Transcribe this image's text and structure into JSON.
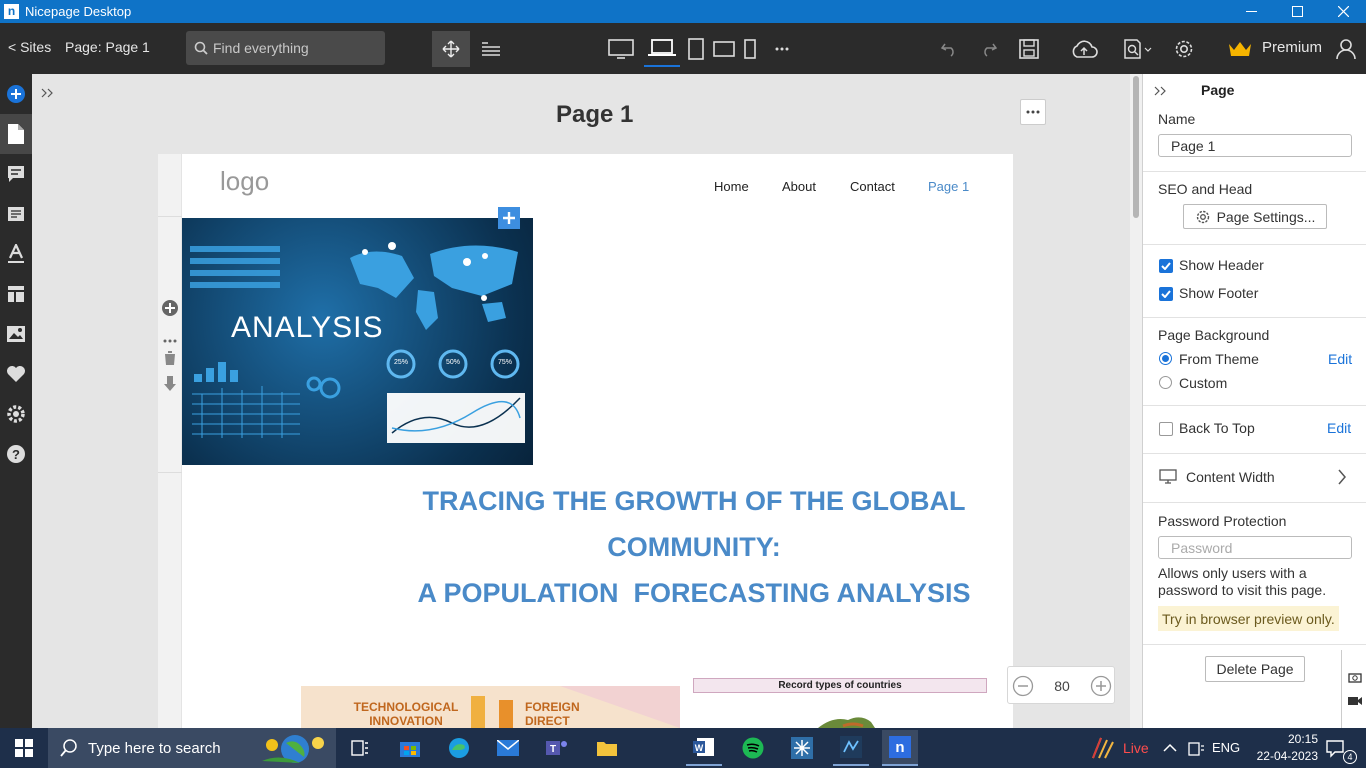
{
  "window": {
    "title": "Nicepage Desktop"
  },
  "toolbar": {
    "sites_label": "< Sites",
    "page_label": "Page: Page 1",
    "search_placeholder": "Find everything",
    "premium_label": "Premium"
  },
  "editor": {
    "page_title": "Page 1",
    "zoom_value": "80"
  },
  "site": {
    "logo_text": "logo",
    "nav": [
      "Home",
      "About",
      "Contact",
      "Page 1"
    ],
    "hero_image_text": "ANALYSIS",
    "donut_labels": [
      "25%",
      "50%",
      "75%"
    ],
    "heading_lines": [
      "TRACING THE GROWTH OF THE GLOBAL",
      "COMMUNITY:",
      "A POPULATION  FORECASTING ANALYSIS"
    ],
    "infographic_left": "TECHNOLOGICAL INNOVATION",
    "infographic_right": "FOREIGN DIRECT INVESTMENT",
    "chart_caption": "Record types of countries"
  },
  "panel": {
    "title": "Page",
    "name_label": "Name",
    "name_value": "Page 1",
    "seo_label": "SEO and Head",
    "page_settings_button": "Page Settings...",
    "show_header_label": "Show Header",
    "show_footer_label": "Show Footer",
    "page_background_label": "Page Background",
    "from_theme_label": "From Theme",
    "custom_label": "Custom",
    "edit_label": "Edit",
    "back_to_top_label": "Back To Top",
    "content_width_label": "Content Width",
    "password_protection_label": "Password Protection",
    "password_placeholder": "Password",
    "password_help": "Allows only users with a password to visit this page.",
    "preview_note": "Try in browser preview only.",
    "delete_page_button": "Delete Page"
  },
  "taskbar": {
    "search_placeholder": "Type here to search",
    "live_label": "Live",
    "language": "ENG",
    "time": "20:15",
    "date": "22-04-2023",
    "notification_count": "4"
  },
  "colors": {
    "accent": "#1a73d9",
    "titlebar": "#0f73c7",
    "heading": "#4a8ac8",
    "toolbar": "#2b2b2b",
    "taskbar": "#1e2f4a"
  }
}
